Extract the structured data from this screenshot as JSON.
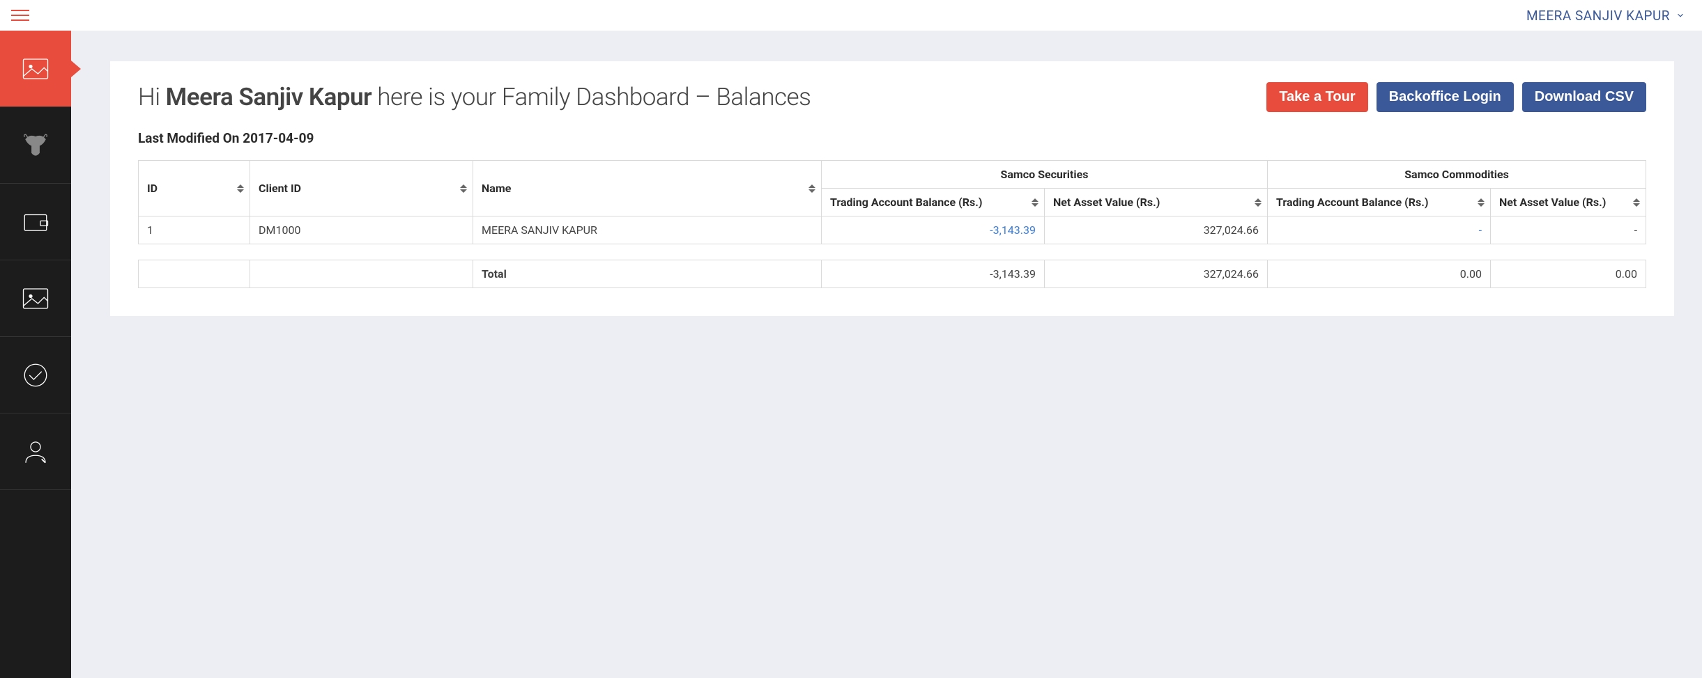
{
  "topbar": {
    "user_name": "MEERA SANJIV KAPUR"
  },
  "page": {
    "greeting_prefix": "Hi ",
    "user_bold": "Meera Sanjiv Kapur",
    "greeting_suffix": " here is your Family Dashboard – Balances",
    "last_modified_label": "Last Modified On ",
    "last_modified_date": "2017-04-09"
  },
  "buttons": {
    "take_tour": "Take a Tour",
    "backoffice_login": "Backoffice Login",
    "download_csv": "Download CSV"
  },
  "table": {
    "group_securities": "Samco Securities",
    "group_commodities": "Samco Commodities",
    "col_id": "ID",
    "col_client_id": "Client ID",
    "col_name": "Name",
    "col_tab": "Trading Account Balance (Rs.)",
    "col_nav": "Net Asset Value (Rs.)",
    "rows": [
      {
        "id": "1",
        "client_id": "DM1000",
        "name": "MEERA SANJIV KAPUR",
        "sec_tab": "-3,143.39",
        "sec_nav": "327,024.66",
        "com_tab": "-",
        "com_nav": "-"
      }
    ],
    "totals": {
      "label": "Total",
      "sec_tab": "-3,143.39",
      "sec_nav": "327,024.66",
      "com_tab": "0.00",
      "com_nav": "0.00"
    }
  }
}
